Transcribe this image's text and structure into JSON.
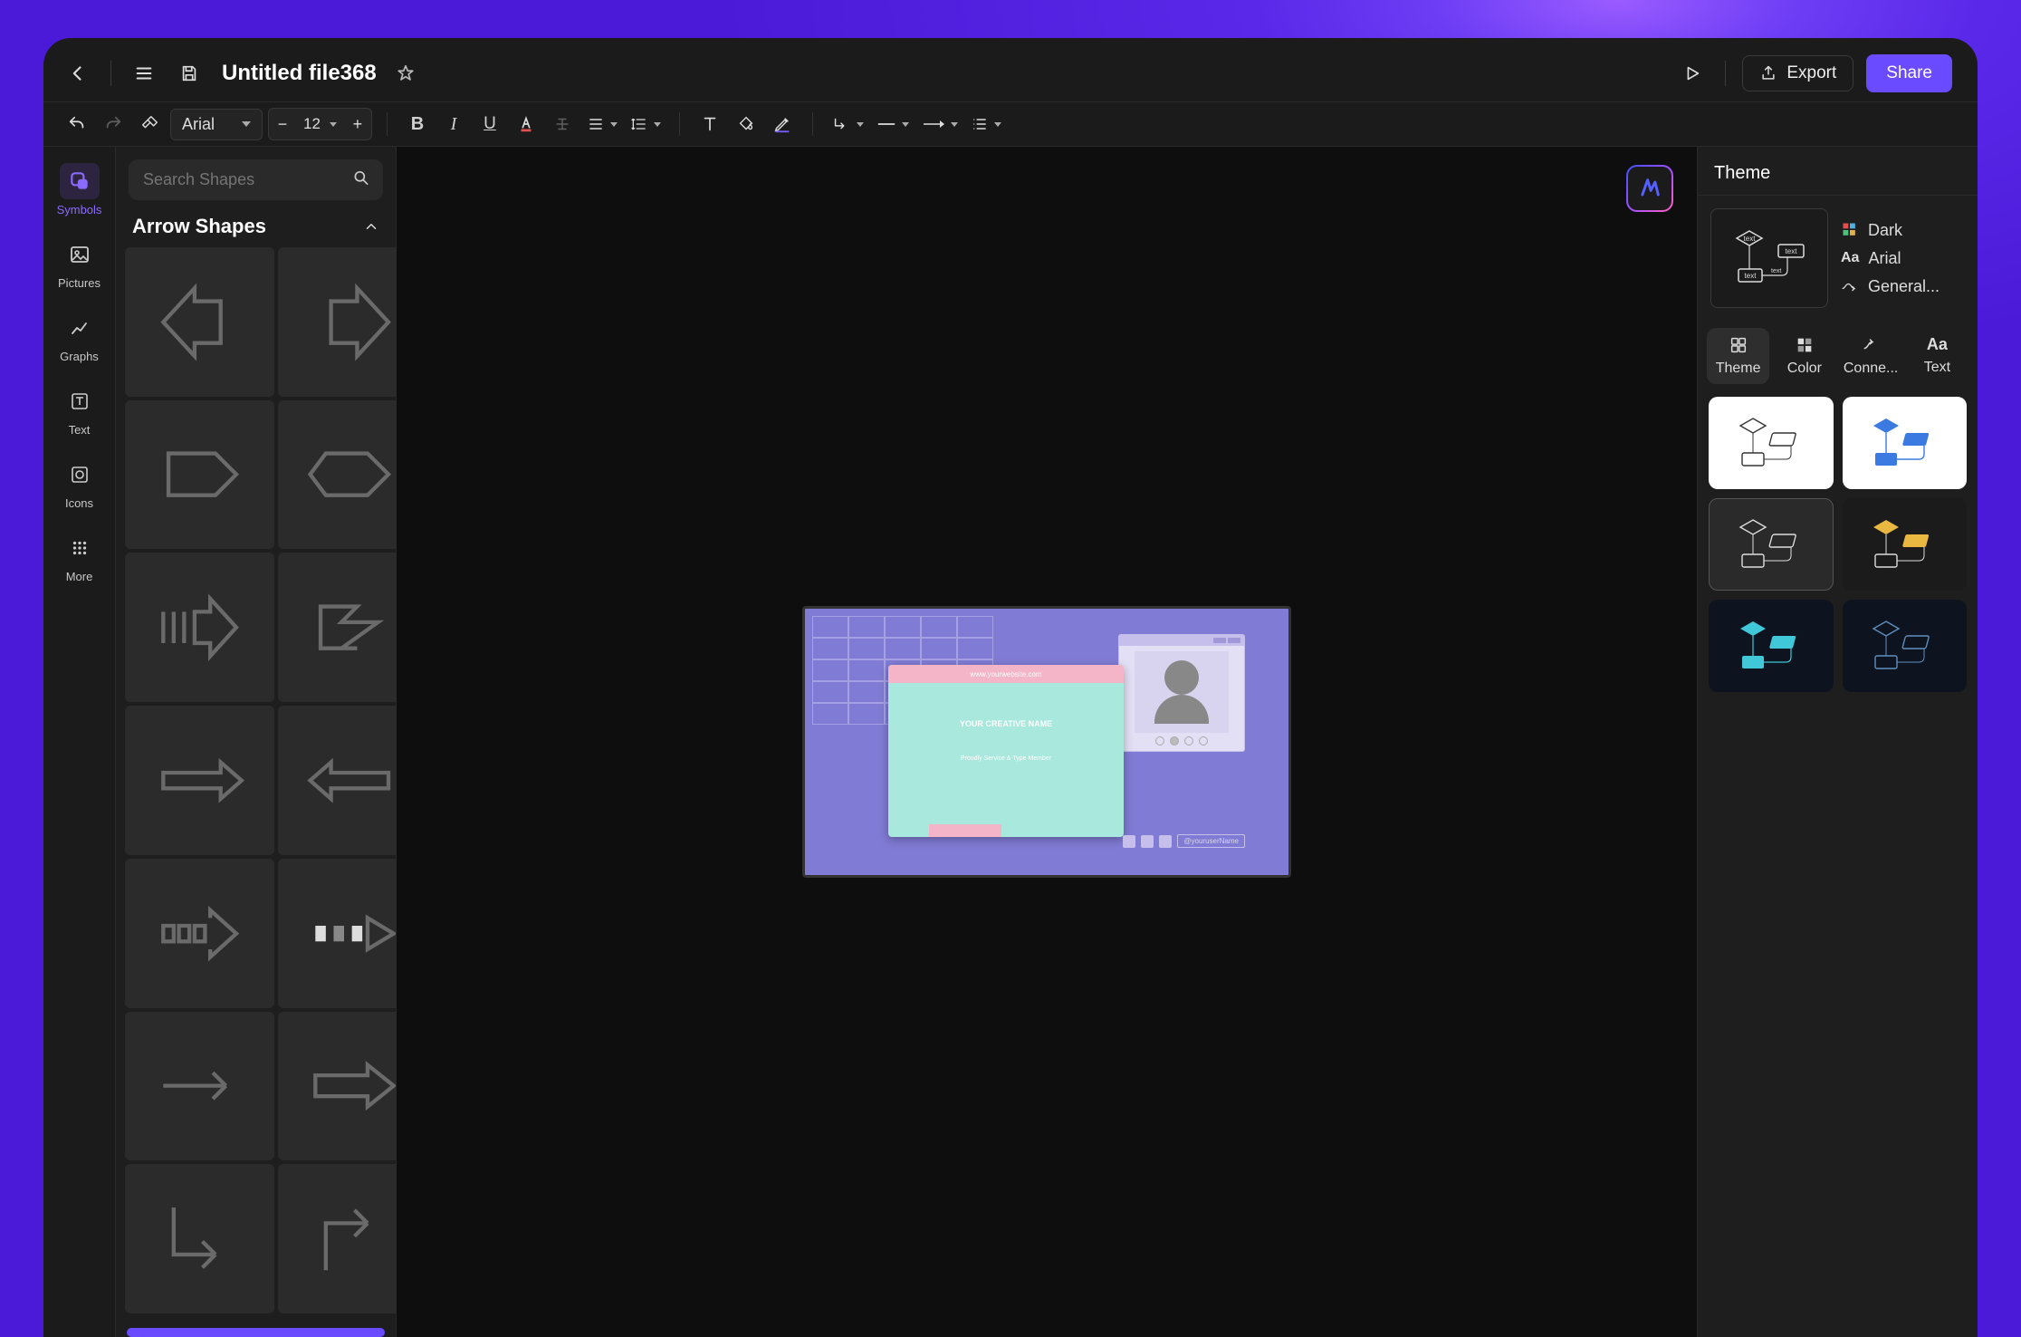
{
  "header": {
    "file_title": "Untitled file368",
    "export_label": "Export",
    "share_label": "Share"
  },
  "toolbar": {
    "font_name": "Arial",
    "font_size": "12"
  },
  "left_rail": {
    "items": [
      {
        "label": "Symbols"
      },
      {
        "label": "Pictures"
      },
      {
        "label": "Graphs"
      },
      {
        "label": "Text"
      },
      {
        "label": "Icons"
      },
      {
        "label": "More"
      }
    ]
  },
  "shapes_panel": {
    "search_placeholder": "Search Shapes",
    "section_title": "Arrow Shapes"
  },
  "canvas": {
    "url_text": "www.yourwebsite.com",
    "hero_text": "YOUR CREATIVE NAME",
    "sub_text": "Proudly Service & Type Member",
    "handle_text": "@youruserName"
  },
  "right_panel": {
    "title": "Theme",
    "theme_name": "Dark",
    "theme_font": "Arial",
    "theme_conn": "General...",
    "tabs": [
      {
        "label": "Theme"
      },
      {
        "label": "Color"
      },
      {
        "label": "Conne..."
      },
      {
        "label": "Text"
      }
    ]
  }
}
